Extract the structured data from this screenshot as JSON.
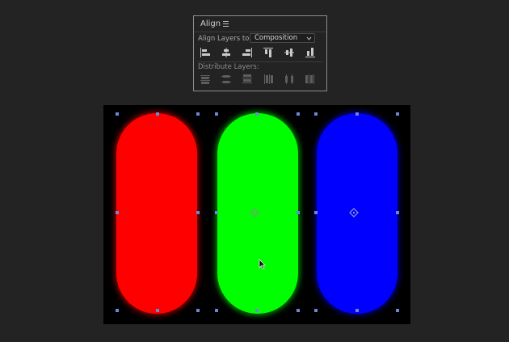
{
  "panel": {
    "title": "Align",
    "menu_icon": "hamburger-menu-icon",
    "align_to_label": "Align Layers to:",
    "align_to_value": "Composition",
    "align_buttons": [
      {
        "name": "align-left-button",
        "icon": "align-left-icon"
      },
      {
        "name": "align-horizontal-center-button",
        "icon": "align-horizontal-center-icon"
      },
      {
        "name": "align-right-button",
        "icon": "align-right-icon"
      },
      {
        "name": "align-top-button",
        "icon": "align-top-icon"
      },
      {
        "name": "align-vertical-center-button",
        "icon": "align-vertical-center-icon"
      },
      {
        "name": "align-bottom-button",
        "icon": "align-bottom-icon"
      }
    ],
    "distribute_label": "Distribute Layers:",
    "distribute_buttons": [
      {
        "name": "distribute-top-button",
        "icon": "distribute-top-icon"
      },
      {
        "name": "distribute-vertical-center-button",
        "icon": "distribute-vertical-center-icon"
      },
      {
        "name": "distribute-bottom-button",
        "icon": "distribute-bottom-icon"
      },
      {
        "name": "distribute-left-button",
        "icon": "distribute-left-icon"
      },
      {
        "name": "distribute-horizontal-center-button",
        "icon": "distribute-horizontal-center-icon"
      },
      {
        "name": "distribute-right-button",
        "icon": "distribute-right-icon"
      }
    ]
  },
  "composition": {
    "background": "#000000",
    "layers": [
      {
        "name": "red-pill-layer",
        "color": "#ff0000",
        "selected": true
      },
      {
        "name": "green-pill-layer",
        "color": "#00ff00",
        "selected": true,
        "anchor_visible": true
      },
      {
        "name": "blue-pill-layer",
        "color": "#0000ff",
        "selected": true,
        "anchor_visible": true
      }
    ],
    "selection_handle_color": "#6f86d4"
  },
  "cursor": "arrow-cursor-icon"
}
